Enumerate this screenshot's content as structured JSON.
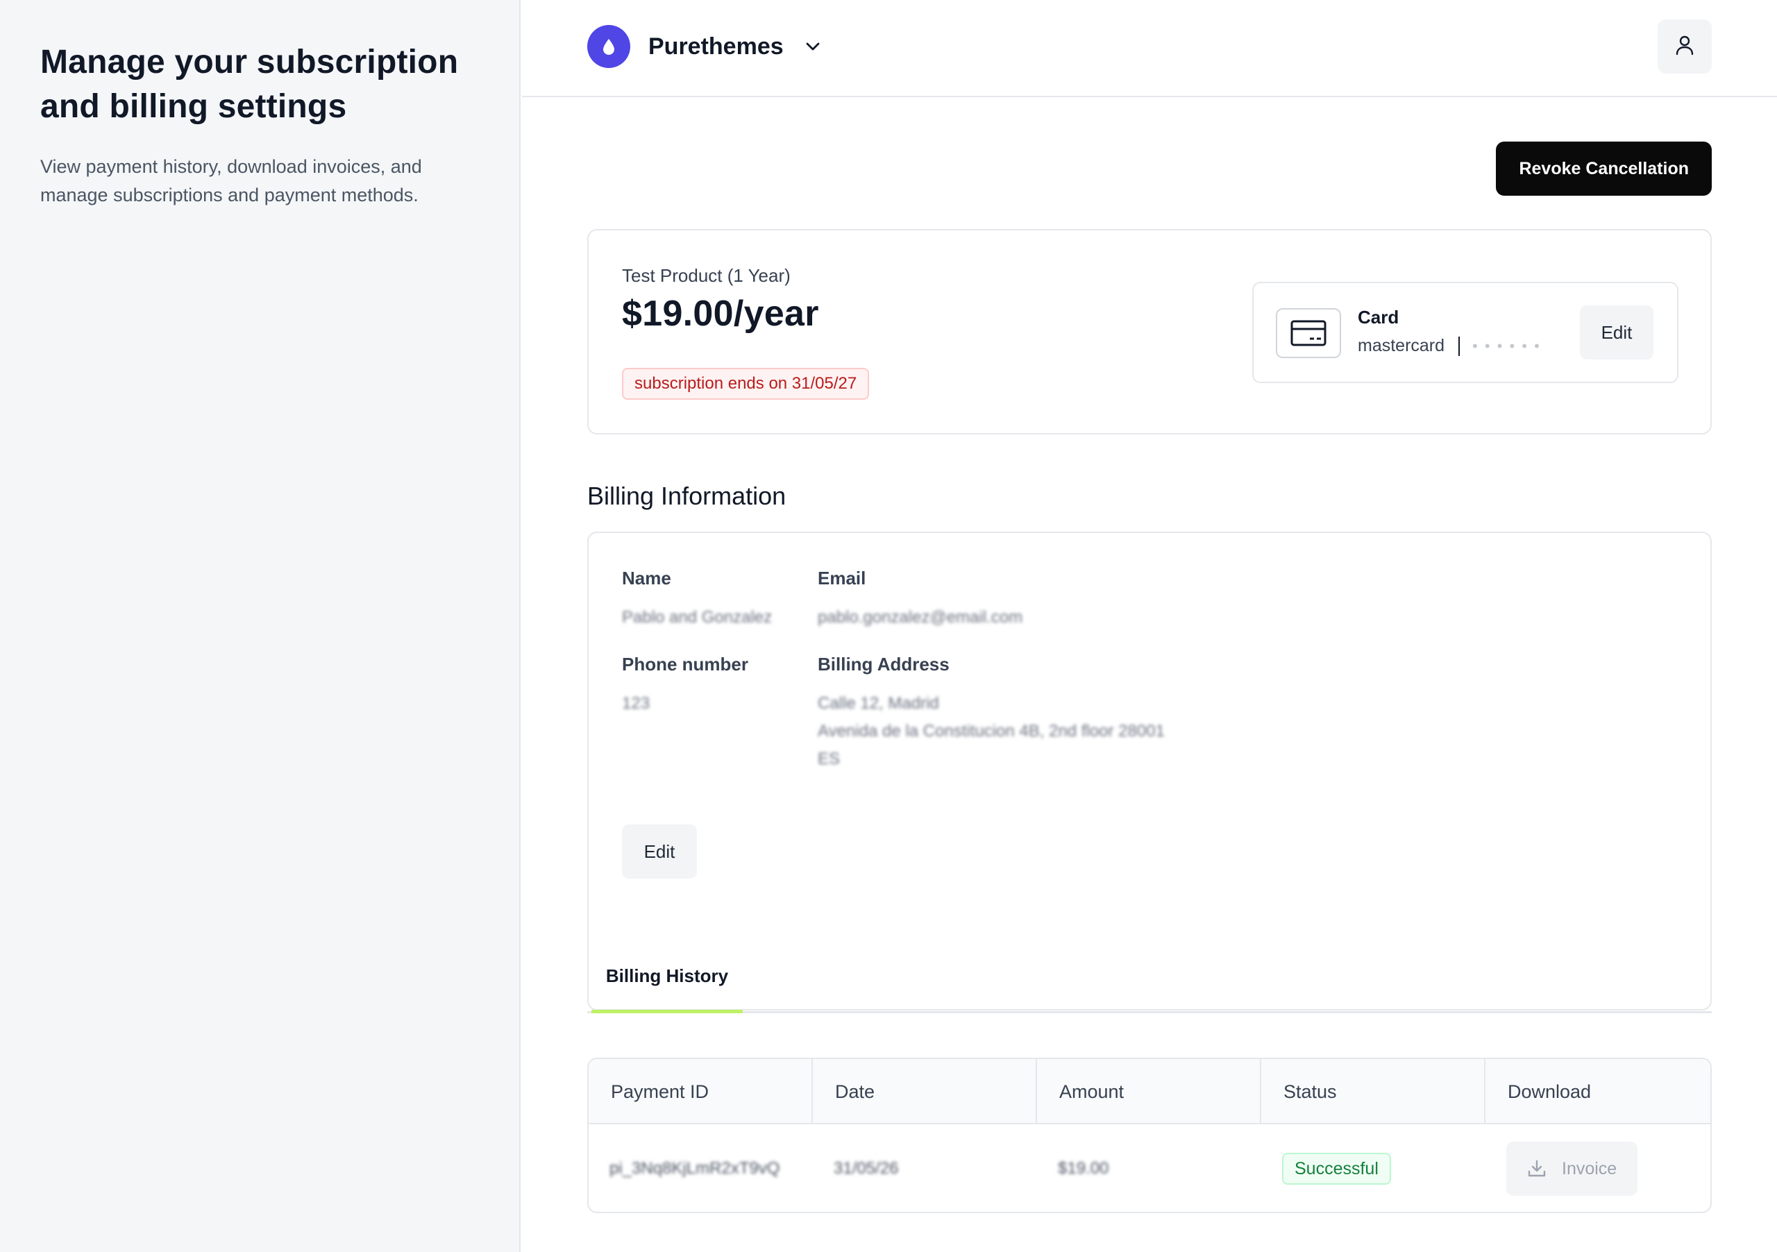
{
  "sidebar": {
    "title": "Manage your subscription and billing settings",
    "description": "View payment history, download invoices, and manage subscriptions and payment methods."
  },
  "header": {
    "brand_name": "Purethemes",
    "brand_icon": "droplet-icon",
    "user_icon": "user-icon",
    "accent_color": "#4f46e5"
  },
  "actions": {
    "revoke_label": "Revoke Cancellation"
  },
  "subscription": {
    "product_name": "Test Product (1 Year)",
    "price": "$19.00/year",
    "ends_badge": "subscription ends on 31/05/27",
    "payment": {
      "title": "Card",
      "brand": "mastercard",
      "number_masked": "• • • • • •",
      "edit_label": "Edit",
      "icon": "credit-card-icon"
    }
  },
  "billing_info": {
    "section_title": "Billing Information",
    "name_label": "Name",
    "name_value": "Pablo and Gonzalez",
    "email_label": "Email",
    "email_value": "pablo.gonzalez@email.com",
    "phone_label": "Phone number",
    "phone_value": "123",
    "address_label": "Billing Address",
    "address_line1": "Calle 12, Madrid",
    "address_line2": "Avenida de la Constitucion 4B, 2nd floor 28001",
    "address_line3": "ES",
    "edit_label": "Edit"
  },
  "billing_history": {
    "tab_label": "Billing History",
    "columns": [
      "Payment ID",
      "Date",
      "Amount",
      "Status",
      "Download"
    ],
    "rows": [
      {
        "payment_id": "pi_3Nq8KjLmR2xT9vQ",
        "date": "31/05/26",
        "amount": "$19.00",
        "status": "Successful",
        "download_label": "Invoice"
      }
    ],
    "tab_underline_color": "#bef264",
    "status_color": "#15803d"
  }
}
